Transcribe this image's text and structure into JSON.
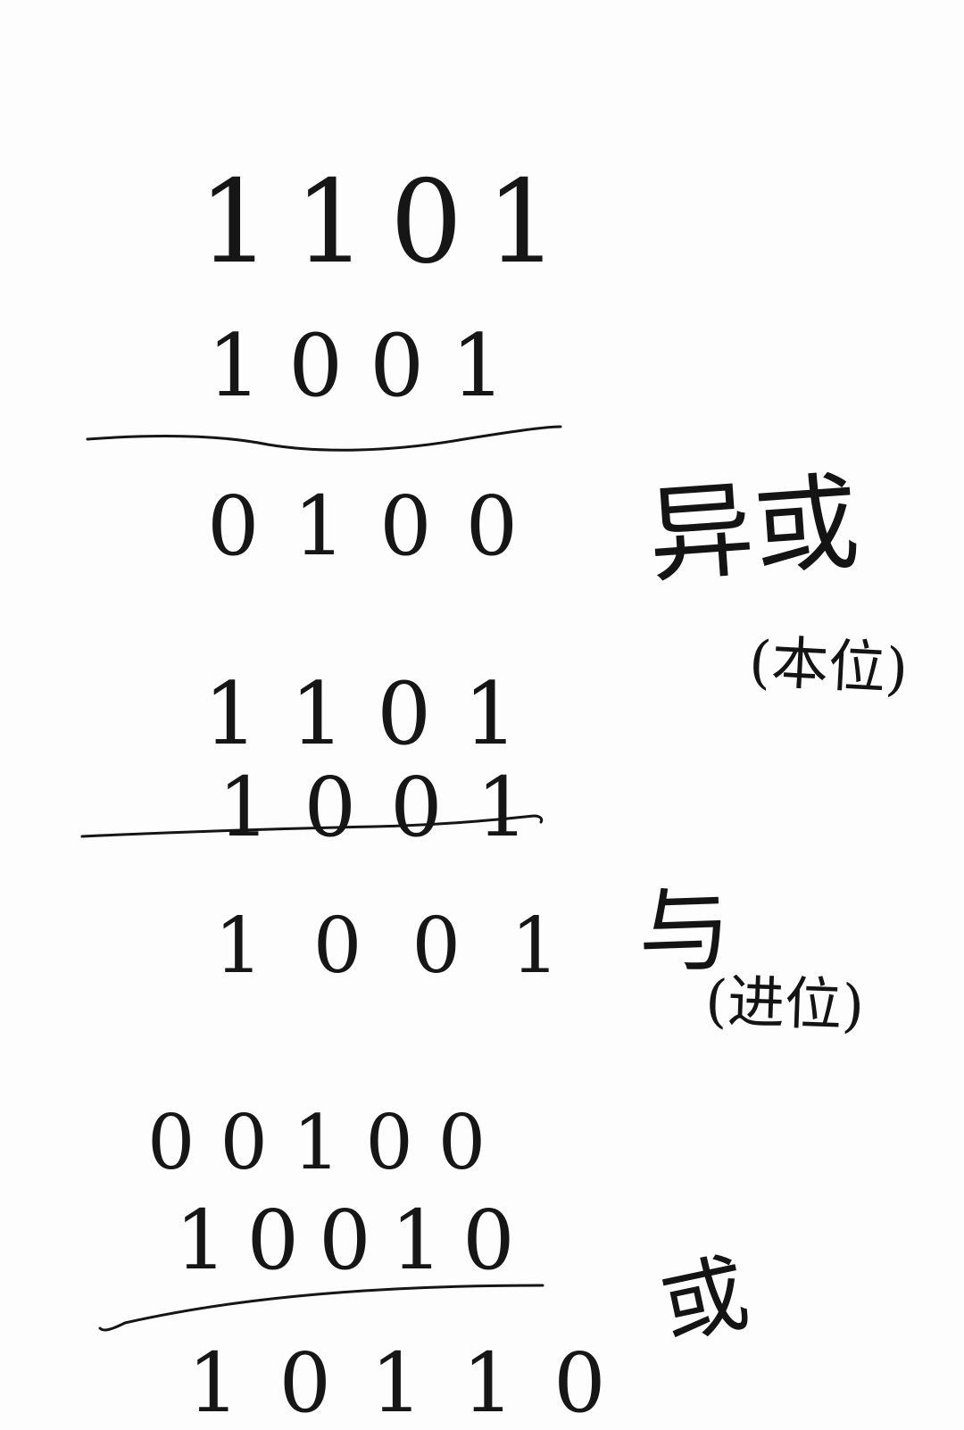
{
  "rows": {
    "a1": "1101",
    "a2": "1001",
    "a3": "0100",
    "b1": "1101",
    "b2": "1001",
    "b3": "1001",
    "c1": "00100",
    "c2": "10010",
    "c3": "10110"
  },
  "notes": {
    "op1": "异或",
    "op1_sub": "(本位)",
    "op2": "与",
    "op2_sub": "(进位)",
    "op3": "或"
  }
}
